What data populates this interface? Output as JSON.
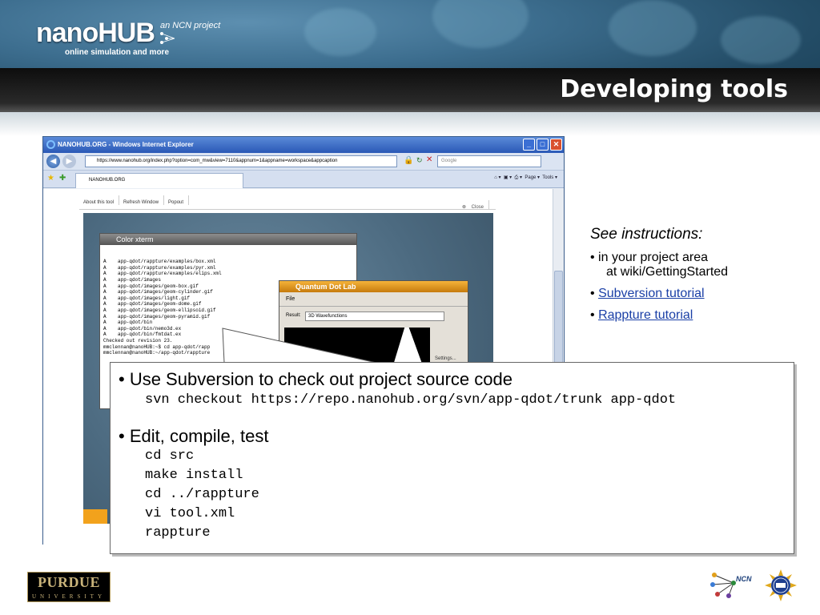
{
  "header": {
    "logo": "nanoHUB",
    "logo_sub": "online simulation and more",
    "ncn_tag": "an NCN project",
    "slide_title": "Developing tools"
  },
  "browser": {
    "title": "NANOHUB.ORG - Windows Internet Explorer",
    "url": "https://www.nanohub.org/index.php?option=com_mw&view=7110&appnum=1&appname=workspace&appcaption",
    "search_placeholder": "Google",
    "tab_label": "NANOHUB.ORG",
    "cmd_page": "Page",
    "cmd_tools": "Tools",
    "tool_actions": [
      "About this tool",
      "Refresh Window",
      "Popout"
    ],
    "close_label": "Close"
  },
  "xterm": {
    "title": "Color xterm",
    "lines": [
      "A    app-qdot/rappture/examples/box.xml",
      "A    app-qdot/rappture/examples/pyr.xml",
      "A    app-qdot/rappture/examples/elips.xml",
      "A    app-qdot/images",
      "A    app-qdot/images/geom-box.gif",
      "A    app-qdot/images/geom-cylinder.gif",
      "A    app-qdot/images/light.gif",
      "A    app-qdot/images/geom-dome.gif",
      "A    app-qdot/images/geom-ellipsoid.gif",
      "A    app-qdot/images/geom-pyramid.gif",
      "A    app-qdot/bin",
      "A    app-qdot/bin/nemo3d.ex",
      "A    app-qdot/bin/fmtdat.ex",
      "Checked out revision 23.",
      "mmclennan@nanoHUB:~$ cd app-qdot/rapp",
      "mmclennan@nanoHUB:~/app-qdot/rappture"
    ]
  },
  "qdot": {
    "title": "Quantum Dot Lab",
    "menu": "File",
    "result_label": "Result:",
    "result_value": "3D Wavefunctions",
    "settings": "Settings..."
  },
  "callout": {
    "bullet1": "• Use Subversion to check out project source code",
    "cmd1": "svn checkout https://repo.nanohub.org/svn/app-qdot/trunk app-qdot",
    "bullet2": "• Edit, compile, test",
    "cmds": [
      "cd src",
      "make install",
      "cd ../rappture",
      "vi tool.xml",
      "rappture"
    ]
  },
  "instructions": {
    "heading": "See instructions:",
    "item1_a": "• in your project area",
    "item1_b": "at wiki/GettingStarted",
    "bullet": "•",
    "link1": "Subversion tutorial",
    "link2": "Rappture tutorial"
  },
  "footer": {
    "purdue": "PURDUE",
    "university": "UNIVERSITY",
    "ncn": "NCN"
  }
}
